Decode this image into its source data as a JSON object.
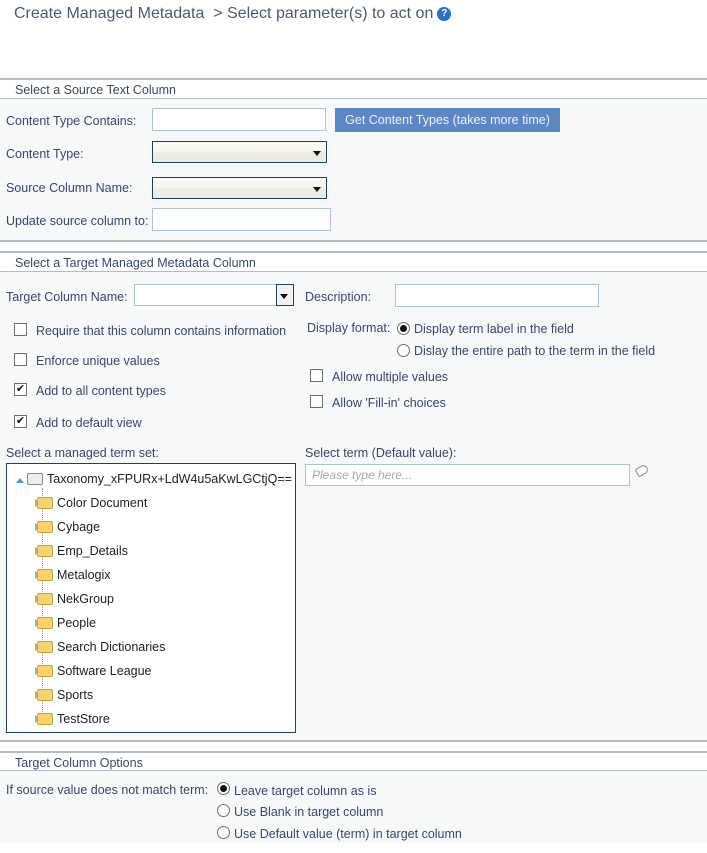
{
  "header": {
    "title": "Create Managed Metadata",
    "subtitle": "> Select parameter(s) to act on",
    "help_icon": "question-circle-icon"
  },
  "source_section": {
    "heading": "Select a Source Text Column",
    "content_type_contains_label": "Content Type Contains:",
    "content_type_contains_value": "",
    "get_content_types_button": "Get Content Types (takes more time)",
    "content_type_label": "Content Type:",
    "content_type_value": "",
    "source_column_label": "Source Column Name:",
    "source_column_value": "",
    "update_source_label": "Update source column to:",
    "update_source_value": ""
  },
  "target_section": {
    "heading": "Select a Target Managed Metadata Column",
    "target_column_label": "Target Column Name:",
    "target_column_value": "",
    "description_label": "Description:",
    "description_value": "",
    "checkboxes": [
      {
        "label": "Require that this column contains information",
        "checked": false
      },
      {
        "label": "Enforce unique values",
        "checked": false
      },
      {
        "label": "Add to all content types",
        "checked": true
      },
      {
        "label": "Add to default view",
        "checked": true
      }
    ],
    "display_format_label": "Display format:",
    "display_format_options": [
      {
        "label": "Display term label in the field",
        "selected": true
      },
      {
        "label": "Dislay the entire path to the term in the field",
        "selected": false
      }
    ],
    "right_checkboxes": [
      {
        "label": "Allow multiple values",
        "checked": false
      },
      {
        "label": "Allow 'Fill-in' choices",
        "checked": false
      }
    ],
    "term_set_label": "Select a managed term set:",
    "tree": {
      "root": "Taxonomy_xFPURx+LdW4u5aKwLGCtjQ==",
      "children": [
        "Color Document",
        "Cybage",
        "Emp_Details",
        "Metalogix",
        "NekGroup",
        "People",
        "Search Dictionaries",
        "Software League",
        "Sports",
        "TestStore"
      ]
    },
    "select_term_label": "Select term (Default value):",
    "select_term_placeholder": "Please type here...",
    "tag_icon": "tag-icon"
  },
  "options_section": {
    "heading": "Target Column Options",
    "mismatch_label": "If source value does not match term:",
    "mismatch_options": [
      {
        "label": "Leave target column as is",
        "selected": true
      },
      {
        "label": "Use Blank in target column",
        "selected": false
      },
      {
        "label": "Use Default value (term) in target column",
        "selected": false
      }
    ]
  }
}
